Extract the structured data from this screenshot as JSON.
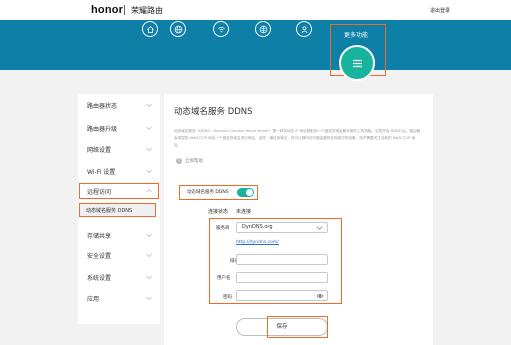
{
  "header": {
    "logo": "honor",
    "brand": "荣耀路由",
    "logout": "退出登录"
  },
  "nav": {
    "icons": [
      "home-icon",
      "globe-icon",
      "wifi-icon",
      "network-icon",
      "user-icon"
    ],
    "more_label": "更多功能",
    "more_icon": "menu-icon"
  },
  "sidebar": {
    "items": [
      {
        "label": "路由器状态"
      },
      {
        "label": "路由器升级"
      },
      {
        "label": "网络设置"
      },
      {
        "label": "Wi-Fi 设置"
      },
      {
        "label": "远程访问"
      },
      {
        "label": "存储共享"
      },
      {
        "label": "安全设置"
      },
      {
        "label": "系统设置"
      },
      {
        "label": "应用"
      }
    ],
    "subitem": "动态域名服务 DDNS"
  },
  "main": {
    "title": "动态域名服务 DDNS",
    "description": "动态域名服务（DDNS：Dynamic Domain Name Server）是一种将动态 IP 地址映射到一个固定的域名解析服务上的机制。当您开启 DDNS 后，路由器会将您的 WAN 口 IP 地址一个固定的域名进行绑定，这样，通过该域名，您可以随时访问路由器所在网络中的设备，而不需要关注当前的 WAN 口 IP 地址。",
    "help": "立即帮助",
    "switch_label": "动态域名服务 DDNS",
    "switch_on": true,
    "connection_label": "连接状态",
    "connection_value": "未连接",
    "provider_label": "服务商",
    "provider_value": "DynDNS.org",
    "provider_link": "http://dyndns.com/",
    "domain_label": "域名",
    "domain_value": "",
    "username_label": "用户名",
    "username_value": "",
    "password_label": "密码",
    "password_value": "",
    "save_label": "保存"
  },
  "colors": {
    "hero": "#0e7fa6",
    "accent": "#17b39d",
    "highlight": "#ee6b2c"
  }
}
